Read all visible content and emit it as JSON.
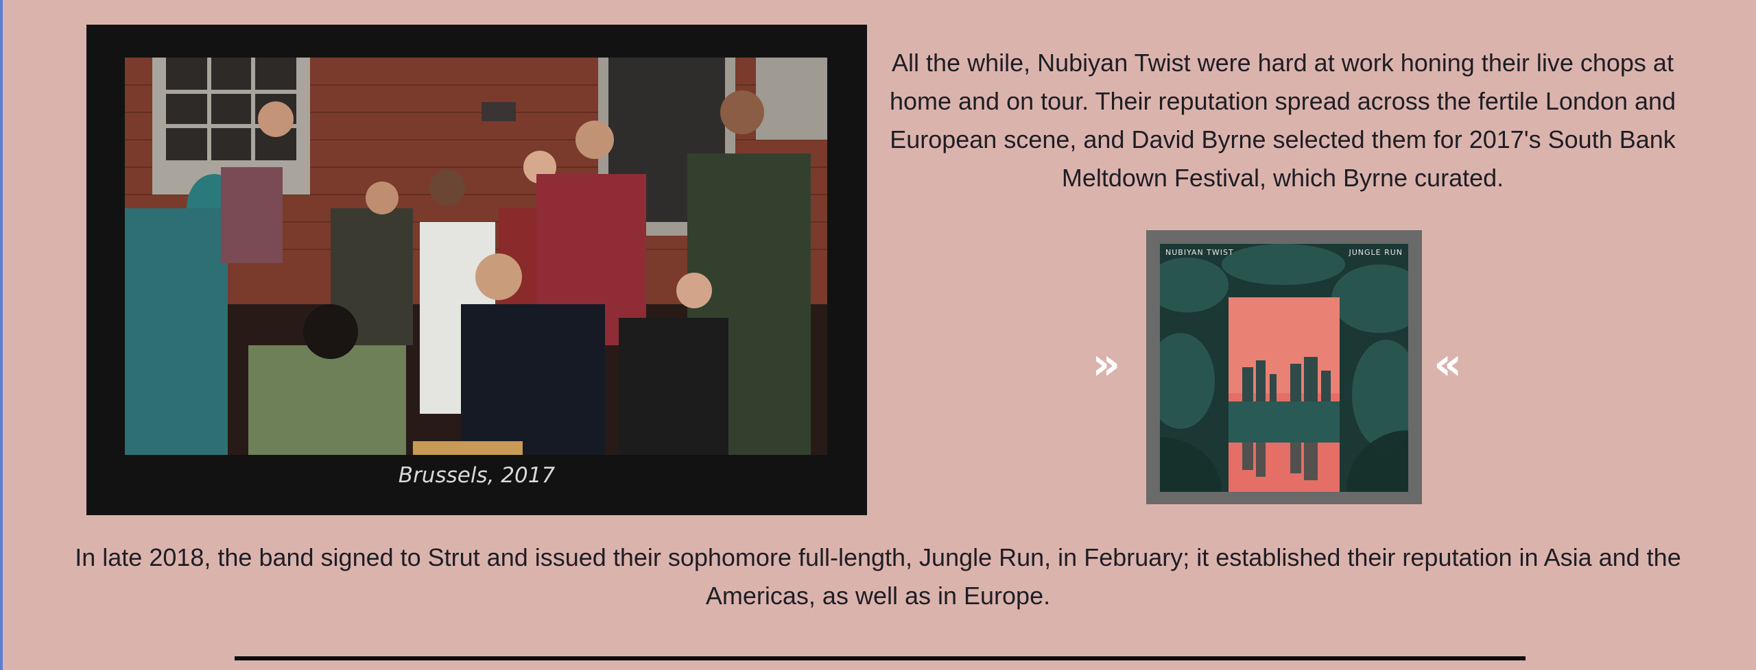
{
  "photo_section": {
    "caption": "Brussels, 2017"
  },
  "paragraph_1": "All the while, Nubiyan Twist were hard at work honing their live chops at home and on tour. Their reputation spread across the fertile London and European scene, and David Byrne selected them for 2017's South Bank Meltdown Festival, which Byrne curated.",
  "album": {
    "artist_label": "NUBIYAN TWIST",
    "title_label": "JUNGLE RUN",
    "prev_glyph": "»",
    "next_glyph": "«"
  },
  "paragraph_2": "In late 2018, the band signed to Strut and issued their sophomore full-length, Jungle Run, in February; it established their reputation in Asia and the Americas, as well as in Europe.",
  "colors": {
    "background": "#dbb3ad",
    "photo_frame": "#121212",
    "album_frame": "#6a6a6a",
    "text": "#1e1e24",
    "divider": "#0c0c0c"
  }
}
